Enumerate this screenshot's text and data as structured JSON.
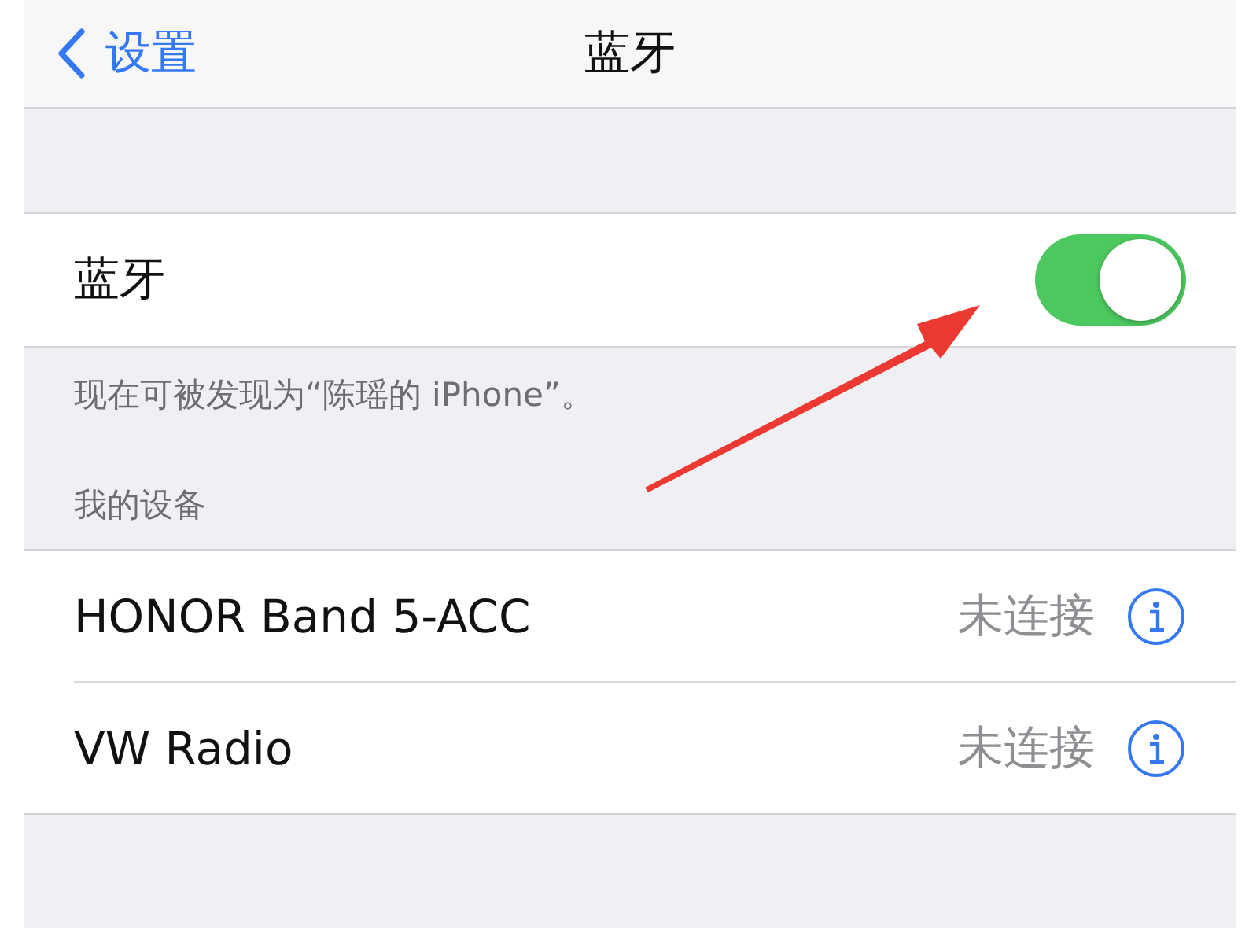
{
  "nav": {
    "back_label": "设置",
    "title": "蓝牙"
  },
  "bluetooth": {
    "label": "蓝牙",
    "on": true
  },
  "discoverable_note": "现在可被发现为“陈瑶的 iPhone”。",
  "my_devices": {
    "header": "我的设备",
    "devices": [
      {
        "name": "HONOR Band 5-ACC",
        "status": "未连接"
      },
      {
        "name": "VW Radio",
        "status": "未连接"
      }
    ]
  }
}
